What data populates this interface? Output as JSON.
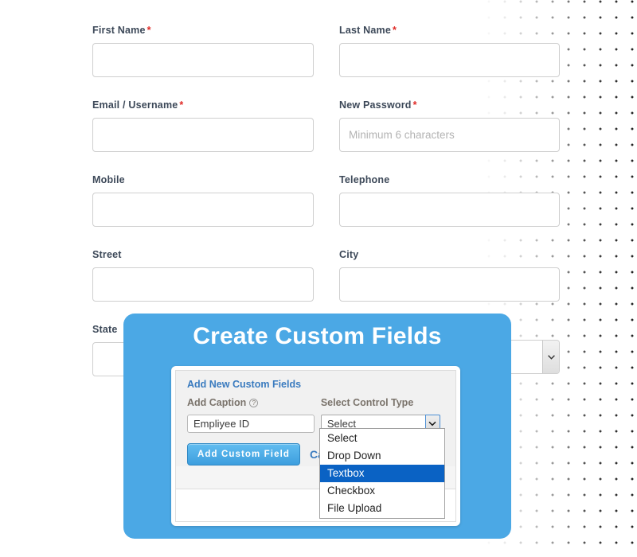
{
  "form": {
    "fields": [
      {
        "label": "First Name",
        "required": true,
        "value": "",
        "placeholder": "",
        "type": "text",
        "col": "left",
        "row": 0
      },
      {
        "label": "Last Name",
        "required": true,
        "value": "",
        "placeholder": "",
        "type": "text",
        "col": "right",
        "row": 0
      },
      {
        "label": "Email / Username",
        "required": true,
        "value": "",
        "placeholder": "",
        "type": "text",
        "col": "left",
        "row": 1
      },
      {
        "label": "New Password",
        "required": true,
        "value": "",
        "placeholder": "Minimum 6 characters",
        "type": "text",
        "col": "right",
        "row": 1
      },
      {
        "label": "Mobile",
        "required": false,
        "value": "",
        "placeholder": "",
        "type": "text",
        "col": "left",
        "row": 2
      },
      {
        "label": "Telephone",
        "required": false,
        "value": "",
        "placeholder": "",
        "type": "text",
        "col": "right",
        "row": 2
      },
      {
        "label": "Street",
        "required": false,
        "value": "",
        "placeholder": "",
        "type": "text",
        "col": "left",
        "row": 3
      },
      {
        "label": "City",
        "required": false,
        "value": "",
        "placeholder": "",
        "type": "text",
        "col": "right",
        "row": 3
      },
      {
        "label": "State",
        "required": false,
        "value": "",
        "placeholder": "",
        "type": "select",
        "col": "left",
        "row": 4
      }
    ],
    "labels": {
      "first_name": "First Name",
      "last_name": "Last Name",
      "email_username": "Email / Username",
      "new_password": "New Password",
      "mobile": "Mobile",
      "telephone": "Telephone",
      "street": "Street",
      "city": "City",
      "state": "State"
    },
    "required_marker": "*",
    "password_placeholder": "Minimum 6 characters",
    "state_select_value": ""
  },
  "modal": {
    "title": "Create Custom Fields",
    "accent_color": "#4ba8e5",
    "panel": {
      "heading": "Add New Custom Fields",
      "caption_label": "Add Caption",
      "caption_help_icon": "question-mark-icon",
      "caption_value": "Empliyee ID",
      "control_type_label": "Select Control Type",
      "control_type_value": "Select",
      "submit_label": "Add Custom Field",
      "cancel_label": "Cancel"
    },
    "dropdown": {
      "open": true,
      "options": [
        "Select",
        "Drop Down",
        "Textbox",
        "Checkbox",
        "File Upload"
      ],
      "highlighted": "Textbox",
      "highlight_color": "#0a62c4"
    }
  },
  "decor": {
    "dot_pattern_name": "dot-grid-pattern"
  }
}
